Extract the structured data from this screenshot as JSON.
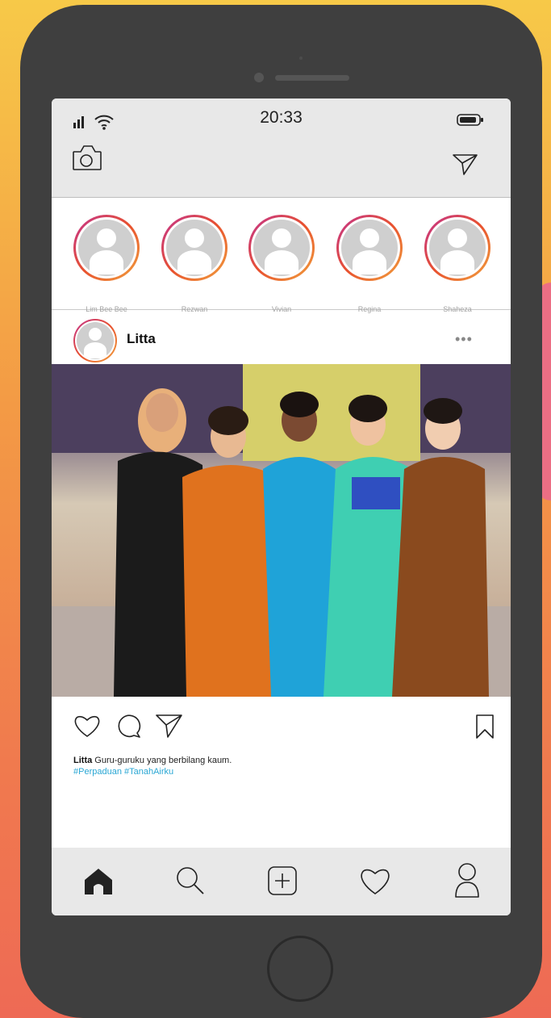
{
  "status_bar": {
    "time": "20:33"
  },
  "stories": [
    {
      "name": "Lim Bee Bee"
    },
    {
      "name": "Rezwan"
    },
    {
      "name": "Vivian"
    },
    {
      "name": "Regina"
    },
    {
      "name": "Shaheza"
    }
  ],
  "post": {
    "username": "Litta",
    "more_label": "•••",
    "caption_user": "Litta",
    "caption_text": " Guru-guruku yang berbilang kaum.",
    "hashtags": "#Perpaduan #TanahAirku"
  },
  "icons": {
    "top_left": "camera-icon",
    "top_right": "send-icon",
    "actions": [
      "heart-icon",
      "comment-icon",
      "share-icon",
      "bookmark-icon"
    ],
    "nav": [
      "home-icon",
      "search-icon",
      "add-post-icon",
      "activity-heart-icon",
      "profile-icon"
    ]
  },
  "colors": {
    "accent_link": "#2aa7d4",
    "story_ring_start": "#c2338f",
    "story_ring_end": "#f1a23c"
  }
}
